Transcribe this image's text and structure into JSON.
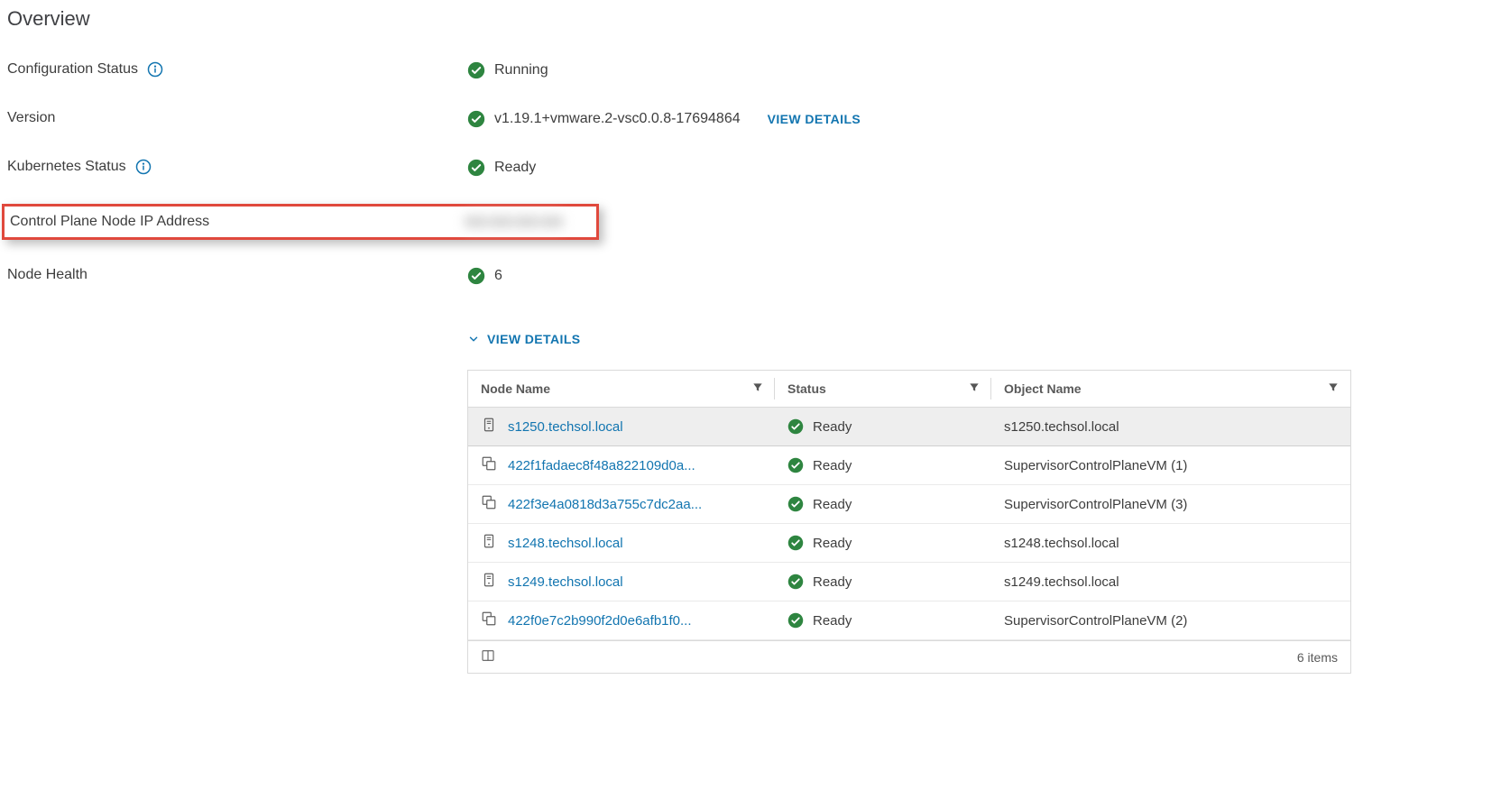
{
  "title": "Overview",
  "rows": {
    "config_status": {
      "label": "Configuration Status",
      "info": true,
      "ok": true,
      "value": "Running"
    },
    "version": {
      "label": "Version",
      "info": false,
      "ok": true,
      "value": "v1.19.1+vmware.2-vsc0.0.8-17694864",
      "details_label": "VIEW DETAILS"
    },
    "k8s_status": {
      "label": "Kubernetes Status",
      "info": true,
      "ok": true,
      "value": "Ready"
    },
    "cp_ip": {
      "label": "Control Plane Node IP Address",
      "value": "xxx.xxx.xxx.xxx"
    },
    "node_health": {
      "label": "Node Health",
      "ok": true,
      "value": "6",
      "expand_label": "VIEW DETAILS"
    }
  },
  "table": {
    "columns": [
      "Node Name",
      "Status",
      "Object Name"
    ],
    "rows": [
      {
        "icon": "host",
        "name": "s1250.techsol.local",
        "status_ok": true,
        "status": "Ready",
        "object": "s1250.techsol.local"
      },
      {
        "icon": "vm",
        "name": "422f1fadaec8f48a822109d0a...",
        "status_ok": true,
        "status": "Ready",
        "object": "SupervisorControlPlaneVM (1)"
      },
      {
        "icon": "vm",
        "name": "422f3e4a0818d3a755c7dc2aa...",
        "status_ok": true,
        "status": "Ready",
        "object": "SupervisorControlPlaneVM (3)"
      },
      {
        "icon": "host",
        "name": "s1248.techsol.local",
        "status_ok": true,
        "status": "Ready",
        "object": "s1248.techsol.local"
      },
      {
        "icon": "host",
        "name": "s1249.techsol.local",
        "status_ok": true,
        "status": "Ready",
        "object": "s1249.techsol.local"
      },
      {
        "icon": "vm",
        "name": "422f0e7c2b990f2d0e6afb1f0...",
        "status_ok": true,
        "status": "Ready",
        "object": "SupervisorControlPlaneVM (2)"
      }
    ],
    "footer_count": "6 items"
  }
}
